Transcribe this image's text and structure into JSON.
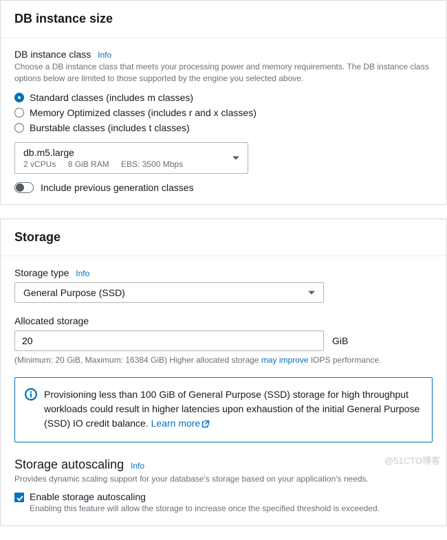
{
  "db_instance_size": {
    "title": "DB instance size",
    "class_label": "DB instance class",
    "info_label": "Info",
    "class_description": "Choose a DB instance class that meets your processing power and memory requirements. The DB instance class options below are limited to those supported by the engine you selected above.",
    "radio_options": [
      {
        "label": "Standard classes (includes m classes)",
        "selected": true
      },
      {
        "label": "Memory Optimized classes (includes r and x classes)",
        "selected": false
      },
      {
        "label": "Burstable classes (includes t classes)",
        "selected": false
      }
    ],
    "selected_instance": {
      "name": "db.m5.large",
      "vcpus": "2 vCPUs",
      "ram": "8 GiB RAM",
      "ebs": "EBS: 3500 Mbps"
    },
    "toggle_label": "Include previous generation classes"
  },
  "storage": {
    "title": "Storage",
    "type_label": "Storage type",
    "info_label": "Info",
    "type_value": "General Purpose (SSD)",
    "allocated_label": "Allocated storage",
    "allocated_value": "20",
    "unit": "GiB",
    "hint_prefix": "(Minimum: 20 GiB, Maximum: 16384 GiB) Higher allocated storage ",
    "hint_link": "may improve",
    "hint_suffix": " IOPS performance.",
    "alert_text": "Provisioning less than 100 GiB of General Purpose (SSD) storage for high throughput workloads could result in higher latencies upon exhaustion of the initial General Purpose (SSD) IO credit balance. ",
    "alert_link": "Learn more",
    "autoscaling": {
      "title": "Storage autoscaling",
      "info_label": "Info",
      "description": "Provides dynamic scaling support for your database's storage based on your application's needs.",
      "checkbox_label": "Enable storage autoscaling",
      "checkbox_description": "Enabling this feature will allow the storage to increase once the specified threshold is exceeded."
    }
  },
  "watermark": "@51CTO博客"
}
